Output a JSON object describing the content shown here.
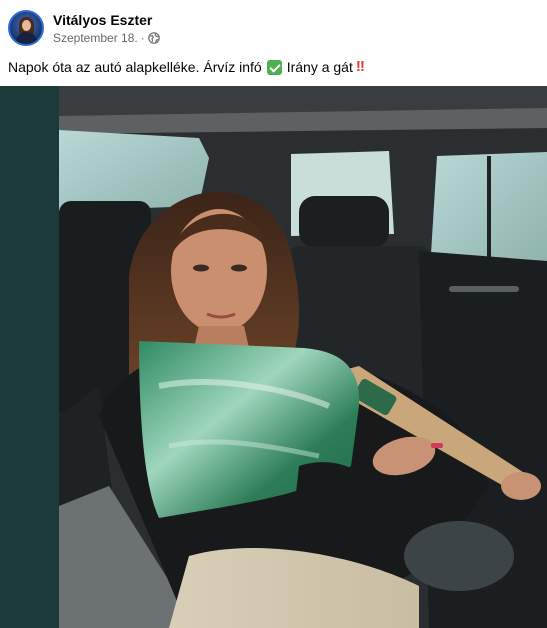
{
  "post": {
    "author": "Vitályos Eszter",
    "date": "Szeptember 18.",
    "separator": "·",
    "privacy_icon": "globe-icon",
    "text_before": "Napok óta az autó alapkelléke. Árvíz infó",
    "check_emoji_icon": "check-mark-emoji",
    "text_after": "Irány a gát",
    "bang_emoji": "‼"
  },
  "colors": {
    "name": "#050505",
    "meta": "#65676b",
    "photo_border": "#1d3a3a"
  }
}
